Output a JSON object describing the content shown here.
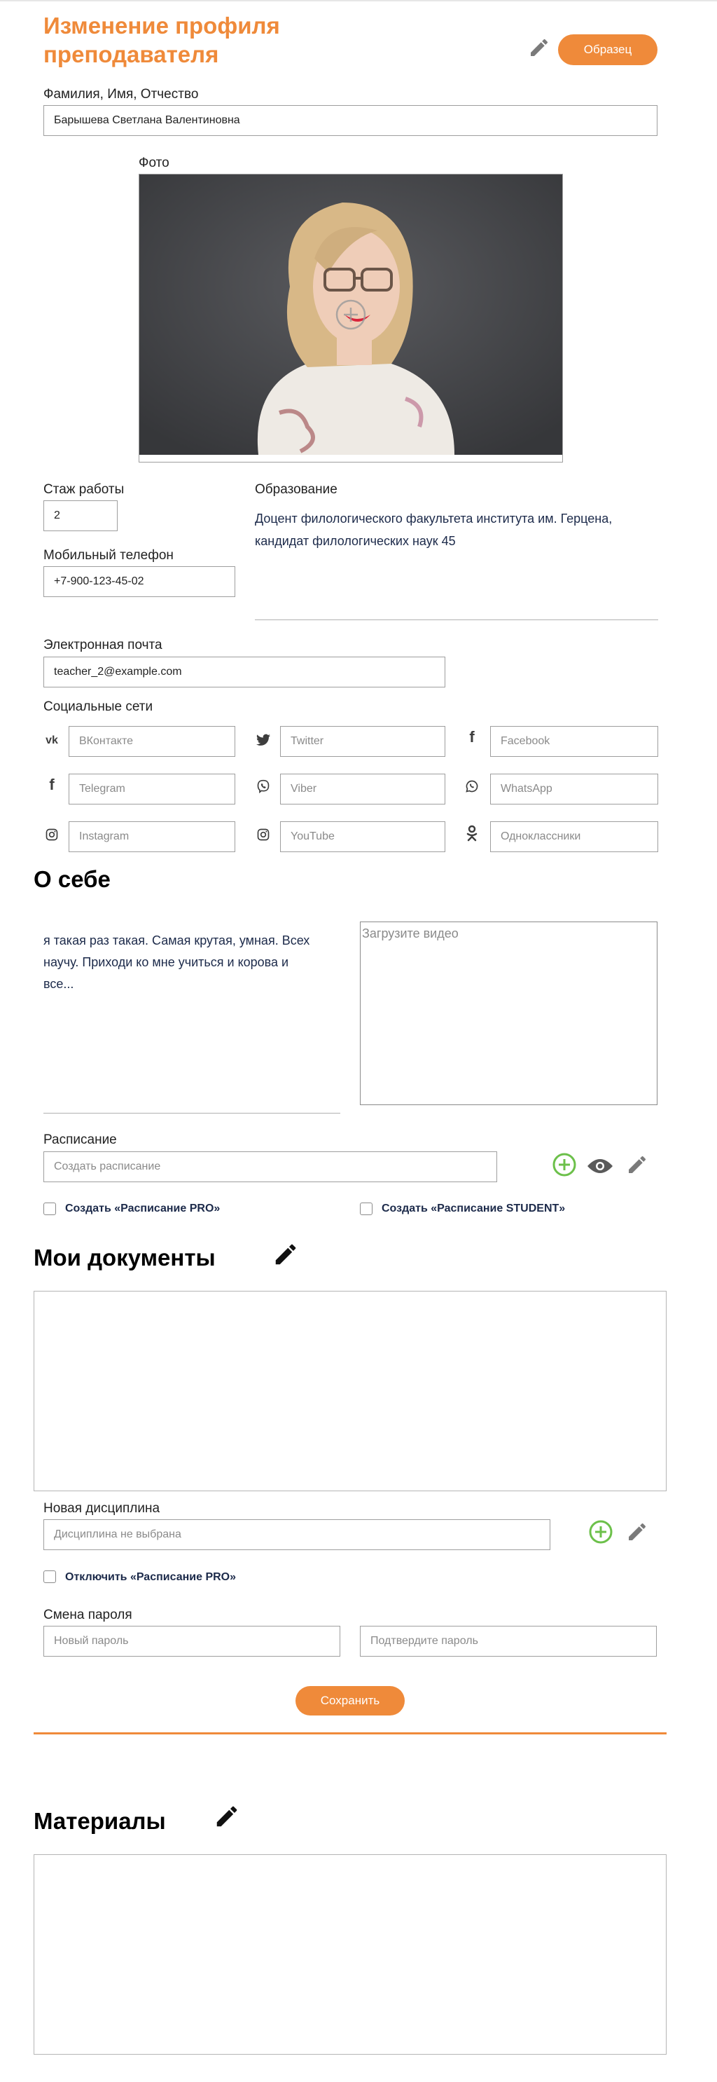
{
  "header": {
    "title_line1": "Изменение профиля",
    "title_line2": "преподавателя",
    "sample_button": "Образец"
  },
  "profile": {
    "fullname_label": "Фамилия, Имя, Отчество",
    "fullname_value": "Барышева Светлана Валентиновна",
    "photo_label": "Фото",
    "experience_label": "Стаж работы",
    "experience_value": "2",
    "education_label": "Образование",
    "education_line1": "Доцент филологического факультета института им. Герцена,",
    "education_line2": "кандидат филологических наук 45",
    "phone_label": "Мобильный телефон",
    "phone_value": "+7-900-123-45-02",
    "email_label": "Электронная почта",
    "email_value": "teacher_2@example.com"
  },
  "social": {
    "label": "Социальные сети",
    "vk": "ВКонтакте",
    "twitter": "Twitter",
    "facebook": "Facebook",
    "telegram": "Telegram",
    "viber": "Viber",
    "whatsapp": "WhatsApp",
    "instagram": "Instagram",
    "youtube": "YouTube",
    "odnoklassniki": "Одноклассники"
  },
  "about": {
    "heading": "О себе",
    "line1": "я такая раз такая. Самая крутая, умная. Всех",
    "line2": "научу. Приходи ко мне учиться и корова и",
    "line3": "все...",
    "video_placeholder": "Загрузите видео"
  },
  "schedule": {
    "label": "Расписание",
    "placeholder": "Создать расписание",
    "pro_checkbox": "Создать «Расписание PRO»",
    "student_checkbox": "Создать «Расписание STUDENT»"
  },
  "documents": {
    "heading": "Мои документы"
  },
  "discipline": {
    "label": "Новая дисциплина",
    "placeholder": "Дисциплина не выбрана",
    "disable_pro": "Отключить «Расписание PRO»"
  },
  "password": {
    "label": "Смена пароля",
    "new_placeholder": "Новый пароль",
    "confirm_placeholder": "Подтвердите пароль"
  },
  "save_button": "Сохранить",
  "materials": {
    "heading": "Материалы"
  },
  "colors": {
    "accent": "#ef8a3a",
    "add_green": "#6cc04a",
    "text_dark": "#1c2a4a"
  }
}
